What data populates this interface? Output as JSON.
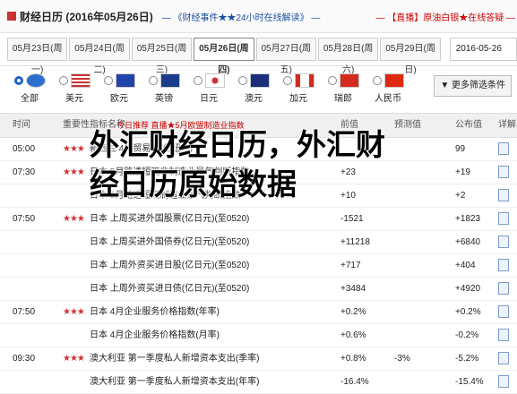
{
  "titlebar": {
    "title": "财经日历 (2016年05月26日)",
    "promo1": "— 《财经事件★★24小时在线解读》 —",
    "promo2": "— 【直播】原油白银★在线答疑 —"
  },
  "date_tabs": [
    {
      "label": "05月23日(周一)"
    },
    {
      "label": "05月24日(周二)"
    },
    {
      "label": "05月25日(周三)"
    },
    {
      "label": "05月26日(周四)"
    },
    {
      "label": "05月27日(周五)"
    },
    {
      "label": "05月28日(周六)"
    },
    {
      "label": "05月29日(周日)"
    }
  ],
  "date_input": "2016-05-26",
  "countries": [
    {
      "label": "全部",
      "color": "#2d6fcf",
      "selected": true
    },
    {
      "label": "美元",
      "color": "#3b5998"
    },
    {
      "label": "欧元",
      "color": "#2244aa"
    },
    {
      "label": "英镑",
      "color": "#1b3c8c"
    },
    {
      "label": "日元",
      "color": "#ffffff"
    },
    {
      "label": "澳元",
      "color": "#1a2f7a"
    },
    {
      "label": "加元",
      "color": "#d52b1e"
    },
    {
      "label": "瑞郎",
      "color": "#d52b1e"
    },
    {
      "label": "人民币",
      "color": "#de2910"
    }
  ],
  "filter_label": "更多筛选条件",
  "headers": {
    "time": "时间",
    "importance": "重要性",
    "indicator": "指标名称",
    "previous": "前值",
    "forecast": "预测值",
    "actual": "公布值",
    "detail": "详解",
    "highlight": "今日推荐  直播★5月欧盟制造业指数"
  },
  "rows": [
    {
      "time": "05:00",
      "stars": "★★★",
      "indicator": "新西兰 4月贸易帐(亿纽元)",
      "previous": "",
      "forecast": "",
      "actual": "99"
    },
    {
      "time": "07:30",
      "stars": "★★★",
      "indicator": "日本 5月路透短观非制造业景气判断指数",
      "previous": "+23",
      "forecast": "",
      "actual": "+19"
    },
    {
      "time": "",
      "stars": "",
      "indicator": "日本 5月路透短观制造业景气判断指数",
      "previous": "+10",
      "forecast": "",
      "actual": "+2"
    },
    {
      "time": "07:50",
      "stars": "★★★",
      "indicator": "日本  上周买进外国股票(亿日元)(至0520)",
      "previous": "-1521",
      "forecast": "",
      "actual": "+1823"
    },
    {
      "time": "",
      "stars": "",
      "indicator": "日本  上周买进外国债券(亿日元)(至0520)",
      "previous": "+11218",
      "forecast": "",
      "actual": "+6840"
    },
    {
      "time": "",
      "stars": "",
      "indicator": "日本  上周外资买进日股(亿日元)(至0520)",
      "previous": "+717",
      "forecast": "",
      "actual": "+404"
    },
    {
      "time": "",
      "stars": "",
      "indicator": "日本  上周外资买进日债(亿日元)(至0520)",
      "previous": "+3484",
      "forecast": "",
      "actual": "+4920"
    },
    {
      "time": "07:50",
      "stars": "★★★",
      "indicator": "日本  4月企业服务价格指数(年率)",
      "previous": "+0.2%",
      "forecast": "",
      "actual": "+0.2%"
    },
    {
      "time": "",
      "stars": "",
      "indicator": "日本  4月企业服务价格指数(月率)",
      "previous": "+0.6%",
      "forecast": "",
      "actual": "-0.2%"
    },
    {
      "time": "09:30",
      "stars": "★★★",
      "indicator": "澳大利亚  第一季度私人新增资本支出(季率)",
      "previous": "+0.8%",
      "forecast": "-3%",
      "actual": "-5.2%"
    },
    {
      "time": "",
      "stars": "",
      "indicator": "澳大利亚  第一季度私人新增资本支出(年率)",
      "previous": "-16.4%",
      "forecast": "",
      "actual": "-15.4%"
    }
  ],
  "overlay": {
    "line1": "外汇财经日历，外汇财",
    "line2": "经日历原始数据"
  }
}
